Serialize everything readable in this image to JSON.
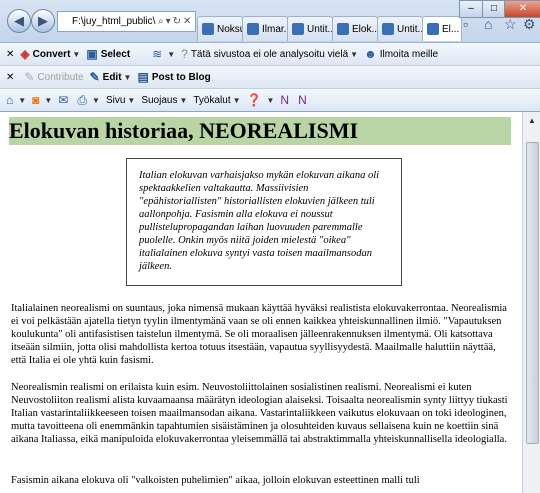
{
  "browser": {
    "address": "F:\\juy_html_public\\",
    "tabs": [
      "Noksu",
      "Ilmar...",
      "Untit...",
      "Elok...",
      "Untit...",
      "El..."
    ],
    "window_controls": [
      "–",
      "□",
      "✕"
    ]
  },
  "toolbar1": {
    "convert_label": "Convert",
    "select_label": "Select",
    "analysis_text": "Tätä sivustoa ei ole analysoitu vielä",
    "report_label": "Ilmoita meille"
  },
  "toolbar2": {
    "contribute_label": "Contribute",
    "edit_label": "Edit",
    "post_label": "Post to Blog"
  },
  "toolbar3": {
    "page_label": "Sivu",
    "safety_label": "Suojaus",
    "tools_label": "Työkalut"
  },
  "page": {
    "title": "Elokuvan historiaa, NEOREALISMI",
    "quote": "Italian elokuvan varhaisjakso mykän elokuvan aikana oli spektaakkelien valtakautta. Massiivisien \"epähistoriallisten\" historiallisten elokuvien jälkeen tuli aallonpohja. Fasismin alla elokuva ei noussut pullistelupropagandan laihan luovuuden paremmalle puolelle. Onkin myös niitä joiden mielestä \"oikea\" italialainen elokuva syntyi vasta toisen maailmansodan jälkeen.",
    "paragraph1": "Italialainen neorealismi on suuntaus, joka nimensä mukaan käyttää hyväksi realistista elokuvakerrontaa. Neorealismia ei voi pelkästään ajatella tietyn tyylin ilmentymänä vaan se oli ennen kaikkea yhteiskunnallinen ilmiö. \"Vapautuksen koulukunta\" oli antifasistisen taistelun ilmentymä. Se oli moraalisen jälleenrakennuksen ilmentymä. Oli katsottava itseään silmiin, jotta olisi mahdollista kertoa totuus itsestään, vapautua syyllisyydestä. Maailmalle haluttiin näyttää, että Italia ei ole yhtä kuin fasismi.",
    "paragraph2": "Neorealismin realismi on erilaista kuin esim. Neuvostoliittolainen sosialistinen realismi. Neorealismi ei kuten Neuvostoliiton realismi alista kuvaamaansa määrätyn ideologian alaiseksi. Toisaalta neorealismin synty liittyy tiukasti Italian vastarintaliikkeeseen toisen maailmansodan aikana. Vastarintaliikkeen vaikutus elokuvaan on toki ideologinen, mutta tavoitteena oli enemmänkin tapahtumien sisäistäminen ja olosuhteiden kuvaus sellaisena kuin ne koettiin sinä aikana Italiassa, eikä manipuloida elokuvakerrontaa yleisemmällä tai abstraktimmalla yhteiskunnallisella ideologialla.",
    "paragraph3": "Fasismin aikana elokuva oli \"valkoisten puhelimien\" aikaa, jolloin elokuvan esteettinen malli tuli"
  }
}
